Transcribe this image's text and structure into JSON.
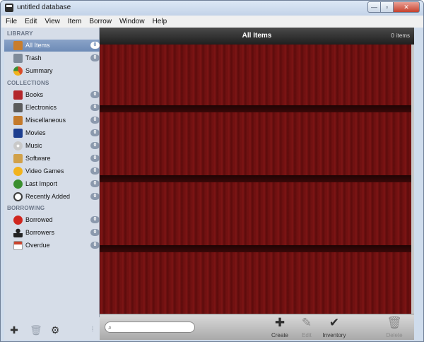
{
  "window": {
    "title": "untitled database",
    "controls": {
      "minimize": "—",
      "maximize": "▫",
      "close": "✕"
    }
  },
  "menu": [
    "File",
    "Edit",
    "View",
    "Item",
    "Borrow",
    "Window",
    "Help"
  ],
  "sidebar": {
    "library_header": "LIBRARY",
    "library": [
      {
        "label": "All Items",
        "count": "0",
        "icon": "all-items-icon",
        "color": "#c87d2c"
      },
      {
        "label": "Trash",
        "count": "0",
        "icon": "trash-icon",
        "color": "#7f8b99"
      },
      {
        "label": "Summary",
        "count": "",
        "icon": "summary-pie-icon",
        "color": "#d94b2b"
      }
    ],
    "collections_header": "COLLECTIONS",
    "collections": [
      {
        "label": "Books",
        "count": "0",
        "icon": "book-icon",
        "color": "#b3262b"
      },
      {
        "label": "Electronics",
        "count": "0",
        "icon": "printer-icon",
        "color": "#5b5b5b"
      },
      {
        "label": "Miscellaneous",
        "count": "0",
        "icon": "box-icon",
        "color": "#c47a2b"
      },
      {
        "label": "Movies",
        "count": "0",
        "icon": "clapper-icon",
        "color": "#1d3e8f"
      },
      {
        "label": "Music",
        "count": "0",
        "icon": "disc-icon",
        "color": "#c9c9c9"
      },
      {
        "label": "Software",
        "count": "0",
        "icon": "tools-icon",
        "color": "#d1a14a"
      },
      {
        "label": "Video Games",
        "count": "0",
        "icon": "smiley-icon",
        "color": "#f2b31c"
      },
      {
        "label": "Last Import",
        "count": "0",
        "icon": "import-arrow-icon",
        "color": "#3a8f2f"
      },
      {
        "label": "Recently Added",
        "count": "0",
        "icon": "clock-icon",
        "color": "#3d3d3d"
      }
    ],
    "borrowing_header": "BORROWING",
    "borrowing": [
      {
        "label": "Borrowed",
        "count": "0",
        "icon": "stop-sign-icon",
        "color": "#d0261e"
      },
      {
        "label": "Borrowers",
        "count": "0",
        "icon": "person-icon",
        "color": "#222222"
      },
      {
        "label": "Overdue",
        "count": "0",
        "icon": "calendar-icon",
        "color": "#c9442e"
      }
    ]
  },
  "main": {
    "title": "All Items",
    "count_value": "0",
    "count_unit": "items"
  },
  "toolbar": {
    "search_placeholder": "",
    "create": "Create",
    "edit": "Edit",
    "inventory": "Inventory",
    "delete": "Delete"
  }
}
